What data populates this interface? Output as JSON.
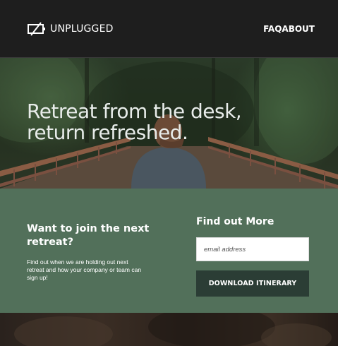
{
  "header": {
    "logo_text": "UNPLUGGED",
    "logo_icon": "unplugged-battery-icon",
    "nav": [
      {
        "label": "FAQ"
      },
      {
        "label": "ABOUT"
      }
    ]
  },
  "hero": {
    "title_line1": "Retreat from the desk,",
    "title_line2": "return refreshed."
  },
  "cta": {
    "heading": "Want to join the next retreat?",
    "description": "Find out when we are holding out next retreat and how your company or team can sign up!",
    "form_title": "Find out More",
    "email_placeholder": "email address",
    "button_label": "DOWNLOAD ITINERARY"
  },
  "colors": {
    "header_bg": "#1e1e1e",
    "cta_bg": "#52705a",
    "button_bg": "#2b3d35"
  }
}
